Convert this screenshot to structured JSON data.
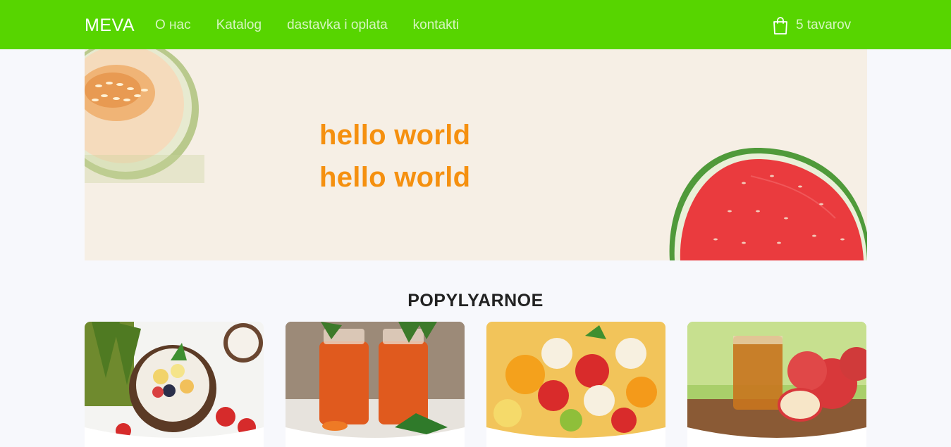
{
  "header": {
    "brand": "MEVA",
    "nav": [
      {
        "label": "О нас"
      },
      {
        "label": "Katalog"
      },
      {
        "label": "dastavka i oplata"
      },
      {
        "label": "kontakti"
      }
    ],
    "cart": {
      "label": "5 tavarov",
      "icon": "shopping-bag-icon"
    }
  },
  "hero": {
    "line1": "hello world",
    "line2": "hello world"
  },
  "popular": {
    "title": "POPYLYARNOE",
    "products": [
      {
        "image": "fruit-salad-in-coconut"
      },
      {
        "image": "carrot-juice-bottles"
      },
      {
        "image": "fruit-salad-bowl"
      },
      {
        "image": "apple-juice-with-apples"
      }
    ]
  },
  "colors": {
    "nav_background": "#57d500",
    "accent_orange": "#f5900f",
    "hero_background": "#f6efe5",
    "page_background": "#f7f8fc"
  }
}
